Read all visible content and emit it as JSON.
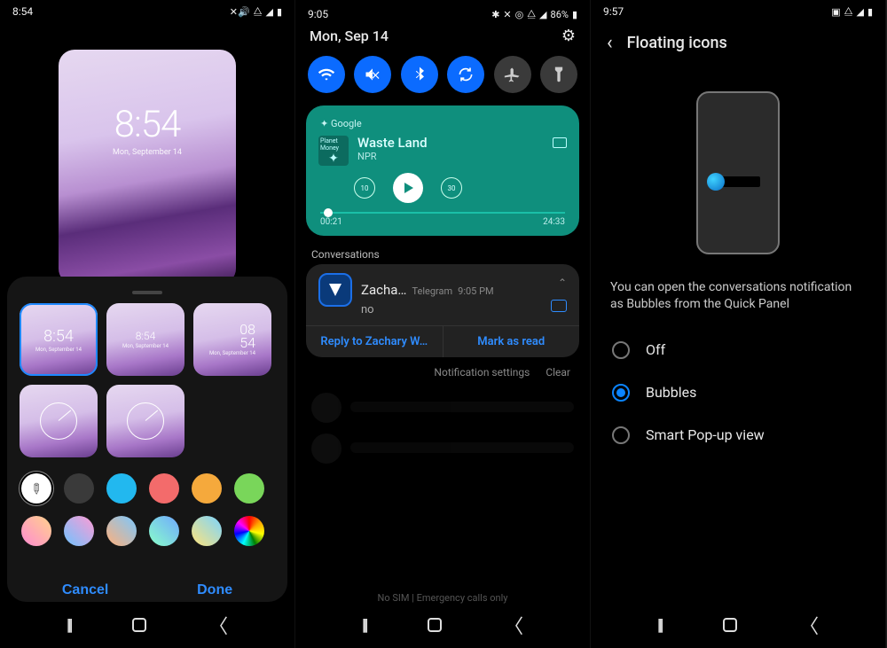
{
  "phone1": {
    "status_time": "8:54",
    "lock_time": "8:54",
    "lock_date": "Mon, September 14",
    "styles": [
      {
        "time": "8:54",
        "date": "Mon, September 14",
        "kind": "digital-big",
        "selected": true
      },
      {
        "time": "8:54",
        "date": "Mon, September 14",
        "kind": "digital-small",
        "selected": false
      },
      {
        "time": "08\n54",
        "date": "Mon, September 14",
        "kind": "digital-stack",
        "selected": false
      },
      {
        "time": "",
        "date": "",
        "kind": "analog-dots",
        "selected": false
      },
      {
        "time": "",
        "date": "",
        "kind": "analog-ticks",
        "selected": false
      }
    ],
    "colors": [
      "#ffffff",
      "#3a3a3a",
      "#22b8ef",
      "#f36b6b",
      "#f5a93c",
      "#79d65a",
      "linear-gradient(45deg,#ff8bd2,#ffd28b)",
      "linear-gradient(45deg,#6fc3ff,#ff9bd4)",
      "linear-gradient(45deg,#ffb07a,#7ac8ff)",
      "linear-gradient(45deg,#8affc9,#6fa8ff)",
      "linear-gradient(45deg,#ffe37a,#7ad4ff)",
      "conic-gradient(red,orange,yellow,green,cyan,blue,magenta,red)"
    ],
    "selected_color_index": 0,
    "cancel_label": "Cancel",
    "done_label": "Done"
  },
  "phone2": {
    "status_time": "9:05",
    "battery_text": "86%",
    "date": "Mon, Sep 14",
    "qs": [
      {
        "name": "wifi",
        "on": true
      },
      {
        "name": "mute-vibrate",
        "on": true
      },
      {
        "name": "bluetooth",
        "on": true
      },
      {
        "name": "auto-rotate",
        "on": true
      },
      {
        "name": "airplane",
        "on": false
      },
      {
        "name": "flashlight",
        "on": false
      }
    ],
    "media": {
      "app": "Google",
      "cast_label": "Planet Money",
      "title": "Waste Land",
      "subtitle": "NPR",
      "rewind_sec": "10",
      "forward_sec": "30",
      "elapsed": "00:21",
      "total": "24:33"
    },
    "conversations_header": "Conversations",
    "convo": {
      "name": "Zacha…",
      "app": "Telegram",
      "time": "9:05 PM",
      "message": "no",
      "reply_label": "Reply to Zachary W…",
      "mark_read_label": "Mark as read"
    },
    "notif_settings_label": "Notification settings",
    "clear_label": "Clear",
    "emergency_label": "No SIM | Emergency calls only"
  },
  "phone3": {
    "status_time": "9:57",
    "title": "Floating icons",
    "description": "You can open the conversations notification as Bubbles from the Quick Panel",
    "options": [
      {
        "label": "Off",
        "selected": false
      },
      {
        "label": "Bubbles",
        "selected": true
      },
      {
        "label": "Smart Pop-up view",
        "selected": false
      }
    ]
  }
}
